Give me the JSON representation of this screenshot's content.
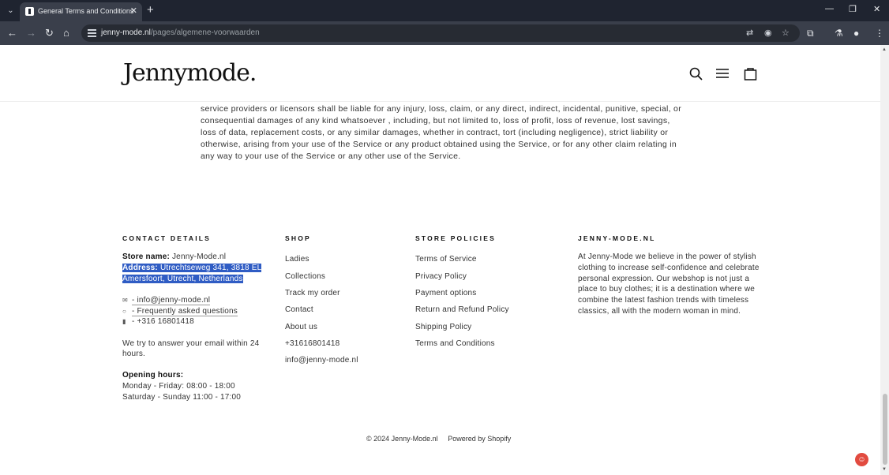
{
  "browser": {
    "tab_title": "General Terms and Conditions",
    "url_host": "jenny-mode.nl",
    "url_path": "/pages/algemene-voorwaarden"
  },
  "header": {
    "logo": "Jennymode."
  },
  "legal_text": "service providers or licensors shall be liable for any injury, loss, claim, or any direct, indirect, incidental, punitive, special, or consequential damages of any kind whatsoever , including, but not limited to, loss of profit, loss of revenue, lost savings, loss of data, replacement costs, or any similar damages, whether in contract, tort (including negligence), strict liability or otherwise, arising from your use of the Service or any product obtained using the Service, or for any other claim relating in any way to your use of the Service or any other use of the Service.",
  "contact": {
    "heading": "CONTACT DETAILS",
    "store_name_label": "Store name:",
    "store_name": "Jenny-Mode.nl",
    "address_label": "Address:",
    "address_line1": "Utrechtseweg 341, 3818 EL",
    "address_line2": "Amersfoort, Utrecht, Netherlands",
    "email": "- info@jenny-mode.nl",
    "faq": "- Frequently asked questions",
    "phone": "- +316 16801418",
    "reply_line1": "We try to answer your email within 24",
    "reply_line2": "hours.",
    "hours_heading": "Opening hours:",
    "hours_weekday": "Monday - Friday: 08:00 - 18:00",
    "hours_weekend": "Saturday - Sunday 11:00 - 17:00"
  },
  "shop": {
    "heading": "SHOP",
    "links": [
      "Ladies",
      "Collections",
      "Track my order",
      "Contact",
      "About us",
      "+31616801418",
      "info@jenny-mode.nl"
    ]
  },
  "policies": {
    "heading": "STORE POLICIES",
    "links": [
      "Terms of Service",
      "Privacy Policy",
      "Payment options",
      "Return and Refund Policy",
      "Shipping Policy",
      "Terms and Conditions"
    ]
  },
  "about": {
    "heading": "JENNY-MODE.NL",
    "lines": [
      "At Jenny-Mode we believe in the power of stylish",
      "clothing to increase self-confidence and celebrate",
      "personal expression. Our webshop is not just a",
      "place to buy clothes; it is a destination where we",
      "combine the latest fashion trends with timeless",
      "classics, all with the modern woman in mind."
    ]
  },
  "footer": {
    "copyright": "© 2024 Jenny-Mode.nl",
    "powered_by": "Powered by Shopify"
  },
  "colors": {
    "selection": "#2f5cc4",
    "chrome_dark": "#1f2430",
    "chrome_toolbar": "#3a3f4b",
    "widget_red": "#e24b40"
  }
}
